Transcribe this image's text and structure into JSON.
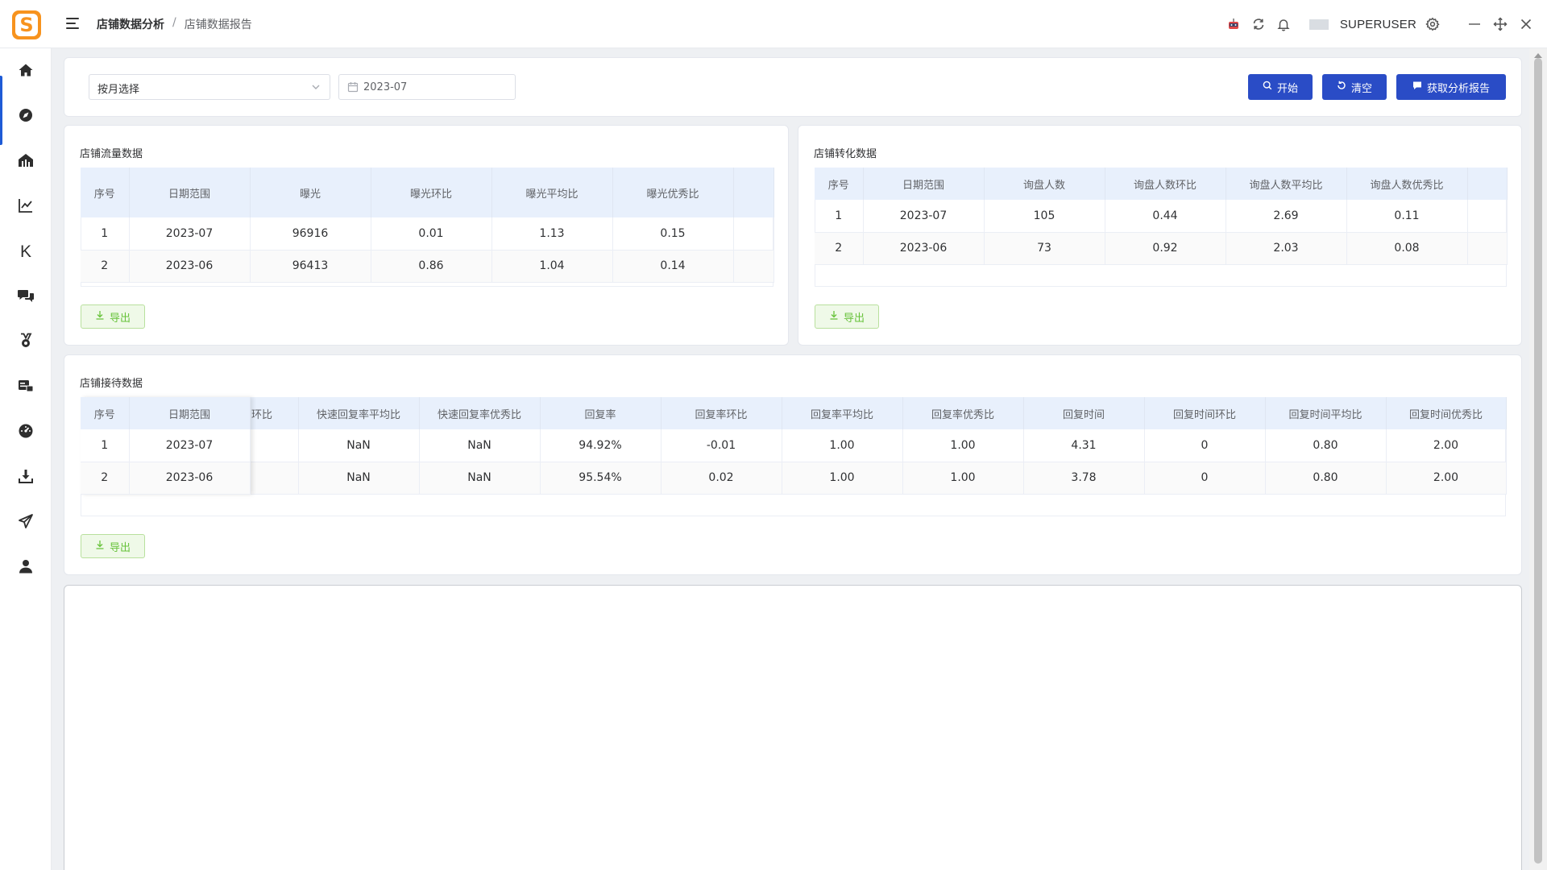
{
  "app": {
    "logo_letter": "S",
    "brand_color": "#f7931e",
    "accent_color": "#2a4cc6"
  },
  "header": {
    "breadcrumb": [
      "店铺数据分析",
      "店铺数据报告"
    ],
    "breadcrumb_separator": "/",
    "username": "SUPERUSER",
    "icons": [
      "robot-icon",
      "refresh-icon",
      "bell-icon",
      "avatar",
      "settings-gear-icon",
      "minimize-icon",
      "move-icon",
      "close-icon"
    ]
  },
  "sidebar": {
    "items": [
      {
        "icon": "home-icon"
      },
      {
        "icon": "compass-icon"
      },
      {
        "icon": "store-icon"
      },
      {
        "icon": "line-chart-icon"
      },
      {
        "icon": "letter-k-icon",
        "glyph": "K"
      },
      {
        "icon": "chat-icon"
      },
      {
        "icon": "medal-icon"
      },
      {
        "icon": "product-icon"
      },
      {
        "icon": "dashboard-icon"
      },
      {
        "icon": "download-icon"
      },
      {
        "icon": "send-icon"
      },
      {
        "icon": "user-icon"
      }
    ]
  },
  "filters": {
    "mode_select": "按月选择",
    "date_value": "2023-07",
    "buttons": {
      "start": "开始",
      "clear": "清空",
      "report": "获取分析报告"
    }
  },
  "traffic": {
    "title": "店铺流量数据",
    "columns": [
      "序号",
      "日期范围",
      "曝光",
      "曝光环比",
      "曝光平均比",
      "曝光优秀比"
    ],
    "rows": [
      [
        "1",
        "2023-07",
        "96916",
        "0.01",
        "1.13",
        "0.15"
      ],
      [
        "2",
        "2023-06",
        "96413",
        "0.86",
        "1.04",
        "0.14"
      ]
    ],
    "export": "导出"
  },
  "conversion": {
    "title": "店铺转化数据",
    "columns": [
      "序号",
      "日期范围",
      "询盘人数",
      "询盘人数环比",
      "询盘人数平均比",
      "询盘人数优秀比"
    ],
    "rows": [
      [
        "1",
        "2023-07",
        "105",
        "0.44",
        "2.69",
        "0.11"
      ],
      [
        "2",
        "2023-06",
        "73",
        "0.92",
        "2.03",
        "0.08"
      ]
    ],
    "export": "导出"
  },
  "reception": {
    "title": "店铺接待数据",
    "fixed_columns": [
      "序号",
      "日期范围"
    ],
    "columns": [
      "环比",
      "快速回复率平均比",
      "快速回复率优秀比",
      "回复率",
      "回复率环比",
      "回复率平均比",
      "回复率优秀比",
      "回复时间",
      "回复时间环比",
      "回复时间平均比",
      "回复时间优秀比"
    ],
    "rows": [
      {
        "fixed": [
          "1",
          "2023-07"
        ],
        "cells": [
          "",
          "NaN",
          "NaN",
          "94.92%",
          "-0.01",
          "1.00",
          "1.00",
          "4.31",
          "0",
          "0.80",
          "2.00"
        ]
      },
      {
        "fixed": [
          "2",
          "2023-06"
        ],
        "cells": [
          "",
          "NaN",
          "NaN",
          "95.54%",
          "0.02",
          "1.00",
          "1.00",
          "3.78",
          "0",
          "0.80",
          "2.00"
        ]
      }
    ],
    "export": "导出"
  }
}
